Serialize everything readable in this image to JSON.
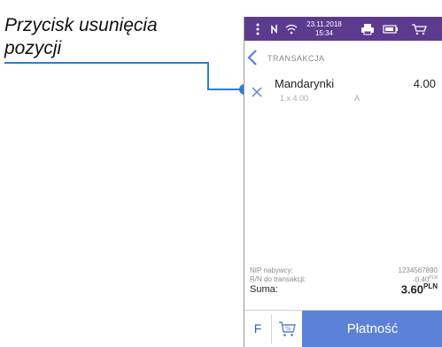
{
  "callout": {
    "label": "Przycisk usunięcia pozycji"
  },
  "status_bar": {
    "date": "23.11.2018",
    "time": "15:34",
    "icons": [
      "more-vert-icon",
      "nfc-icon",
      "wifi-icon",
      "printer-icon",
      "battery-icon",
      "cart-icon"
    ]
  },
  "header": {
    "title": "TRANSAKCJA"
  },
  "items": [
    {
      "name": "Mandarynki",
      "quantity": "1 x 4.00",
      "vat": "A",
      "price": "4.00"
    }
  ],
  "summary": {
    "nip_label": "NIP nabywcy:",
    "nip_value": "1234567890",
    "rn_label": "R/N do transakcji:",
    "rn_value": "-0.40",
    "rn_currency": "PLN",
    "total_label": "Suma:",
    "total_value": "3.60",
    "total_currency": "PLN"
  },
  "bottom_bar": {
    "f_label": "F",
    "pay_label": "Płatność"
  },
  "colors": {
    "status_bar": "#5c3a8e",
    "accent": "#5b82d6",
    "callout": "#2b7fd1"
  }
}
